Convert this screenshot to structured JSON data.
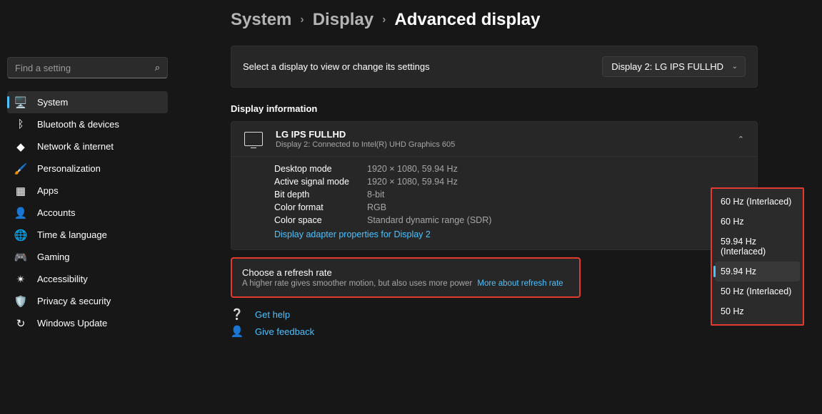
{
  "search": {
    "placeholder": "Find a setting"
  },
  "sidebar": {
    "items": [
      {
        "label": "System",
        "icon": "🖥️",
        "active": true
      },
      {
        "label": "Bluetooth & devices",
        "icon": "ᛒ"
      },
      {
        "label": "Network & internet",
        "icon": "◆"
      },
      {
        "label": "Personalization",
        "icon": "🖌️"
      },
      {
        "label": "Apps",
        "icon": "▦"
      },
      {
        "label": "Accounts",
        "icon": "👤"
      },
      {
        "label": "Time & language",
        "icon": "🌐"
      },
      {
        "label": "Gaming",
        "icon": "🎮"
      },
      {
        "label": "Accessibility",
        "icon": "✴"
      },
      {
        "label": "Privacy & security",
        "icon": "🛡️"
      },
      {
        "label": "Windows Update",
        "icon": "↻"
      }
    ]
  },
  "breadcrumb": {
    "seg0": "System",
    "seg1": "Display",
    "seg2": "Advanced display"
  },
  "select_panel": {
    "label": "Select a display to view or change its settings",
    "selected": "Display 2: LG IPS FULLHD"
  },
  "display_info": {
    "section_title": "Display information",
    "name": "LG IPS FULLHD",
    "subtitle": "Display 2: Connected to Intel(R) UHD Graphics 605",
    "rows": [
      {
        "k": "Desktop mode",
        "v": "1920 × 1080, 59.94 Hz"
      },
      {
        "k": "Active signal mode",
        "v": "1920 × 1080, 59.94 Hz"
      },
      {
        "k": "Bit depth",
        "v": "8-bit"
      },
      {
        "k": "Color format",
        "v": "RGB"
      },
      {
        "k": "Color space",
        "v": "Standard dynamic range (SDR)"
      }
    ],
    "adapter_link": "Display adapter properties for Display 2"
  },
  "refresh": {
    "title": "Choose a refresh rate",
    "desc": "A higher rate gives smoother motion, but also uses more power",
    "more_link": "More about refresh rate",
    "options": [
      {
        "label": "60 Hz (Interlaced)"
      },
      {
        "label": "60 Hz"
      },
      {
        "label": "59.94 Hz (Interlaced)"
      },
      {
        "label": "59.94 Hz",
        "selected": true
      },
      {
        "label": "50 Hz (Interlaced)"
      },
      {
        "label": "50 Hz"
      }
    ]
  },
  "help": {
    "get_help": "Get help",
    "give_feedback": "Give feedback"
  }
}
